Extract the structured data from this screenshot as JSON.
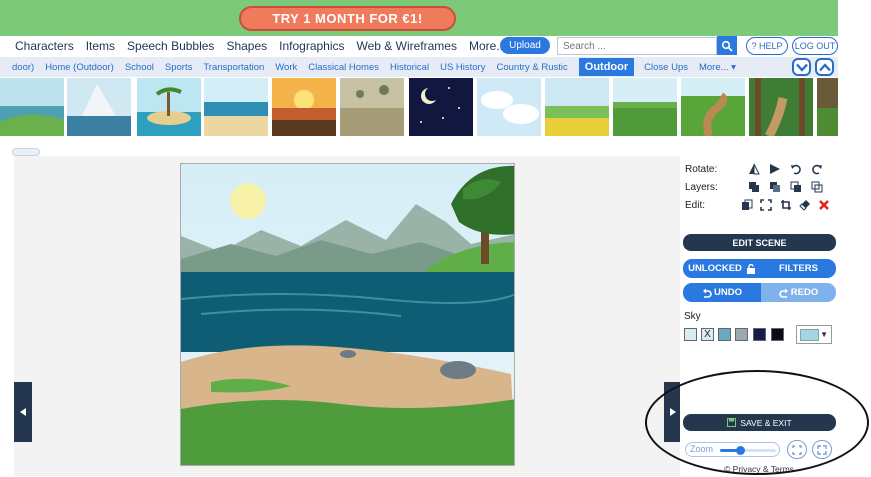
{
  "promo": {
    "label": "TRY 1 MONTH FOR €1!"
  },
  "menu": {
    "items": [
      "Characters",
      "Items",
      "Speech Bubbles",
      "Shapes",
      "Infographics",
      "Web & Wireframes",
      "More... ▾"
    ],
    "upload_label": "Upload",
    "search_placeholder": "Search ...",
    "help_label": "? HELP",
    "logout_label": "LOG OUT"
  },
  "categories": {
    "tabs": [
      "door)",
      "Home (Outdoor)",
      "School",
      "Sports",
      "Transportation",
      "Work",
      "Classical Homes",
      "Historical",
      "US History",
      "Country & Rustic",
      "Outdoor",
      "Close Ups",
      "More... ▾"
    ],
    "active": "Outdoor"
  },
  "panel": {
    "rotate_label": "Rotate:",
    "layers_label": "Layers:",
    "edit_label": "Edit:",
    "edit_scene_label": "EDIT SCENE",
    "unlocked_label": "UNLOCKED",
    "filters_label": "FILTERS",
    "undo_label": "UNDO",
    "redo_label": "REDO",
    "sky_label": "Sky",
    "sky_swatches": [
      "#d7ecf5",
      "#d7ecf5",
      "#6aa8c4",
      "#9aa8b0",
      "#171a4a",
      "#0a0a18"
    ],
    "sky_selected_mark": "X",
    "sky_selected_color": "#a8d3e3",
    "save_exit_label": "SAVE & EXIT",
    "zoom_label": "Zoom",
    "zoom_level": 0.33,
    "privacy_label": "© Privacy & Terms"
  },
  "colors": {
    "promo_green": "#7cc97a",
    "promo_orange": "#f07a5c",
    "accent_blue": "#2a79e0",
    "navy": "#25374f"
  }
}
